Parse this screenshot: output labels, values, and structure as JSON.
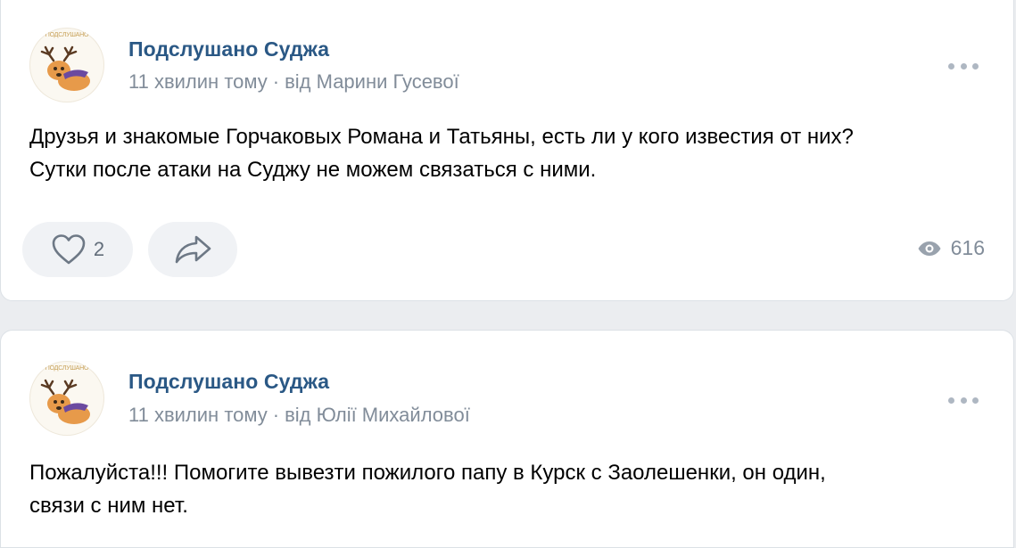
{
  "posts": [
    {
      "author": "Подслушано Суджа",
      "avatar_text": "ПОДСЛУШАНО",
      "time": "11 хвилин тому",
      "separator": "·",
      "by": "від Марини Гусевої",
      "text_line1": "Друзья и знакомые Горчаковых Романа и Татьяны, есть ли у кого известия от них?",
      "text_line2": "Сутки после атаки на Суджу не можем связаться с ними.",
      "likes": "2",
      "views": "616"
    },
    {
      "author": "Подслушано Суджа",
      "avatar_text": "ПОДСЛУШАНО",
      "time": "11 хвилин тому",
      "separator": "·",
      "by": "від Юлії Михайлової",
      "text_line1": "Пожалуйста!!! Помогите вывезти пожилого папу в Курск с Заолешенки, он один,",
      "text_line2": "связи с ним нет."
    }
  ],
  "icons": {
    "like": "heart-icon",
    "share": "share-icon",
    "views": "eye-icon",
    "more": "more-icon"
  },
  "colors": {
    "author": "#2a5885",
    "meta": "#818c99",
    "page_background": "#ebedf0",
    "button_background": "#f0f2f5"
  }
}
